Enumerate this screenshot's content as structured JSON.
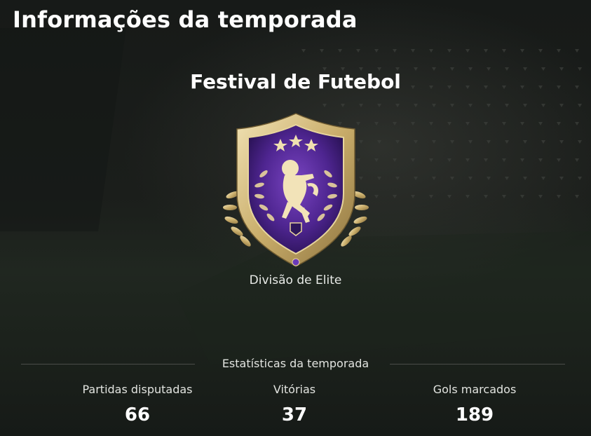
{
  "page": {
    "title": "Informações da temporada"
  },
  "season": {
    "name": "Festival de Futebol",
    "division": "Divisão de Elite",
    "badge_icon": "elite-division-lion-crest-icon"
  },
  "stats": {
    "header": "Estatísticas da temporada",
    "items": [
      {
        "label": "Partidas disputadas",
        "value": "66"
      },
      {
        "label": "Vitórias",
        "value": "37"
      },
      {
        "label": "Gols marcados",
        "value": "189"
      }
    ]
  },
  "colors": {
    "background": "#1b1e1b",
    "text": "#ffffff",
    "badge_gold": "#d8c28a",
    "badge_purple": "#5a2a9a"
  }
}
